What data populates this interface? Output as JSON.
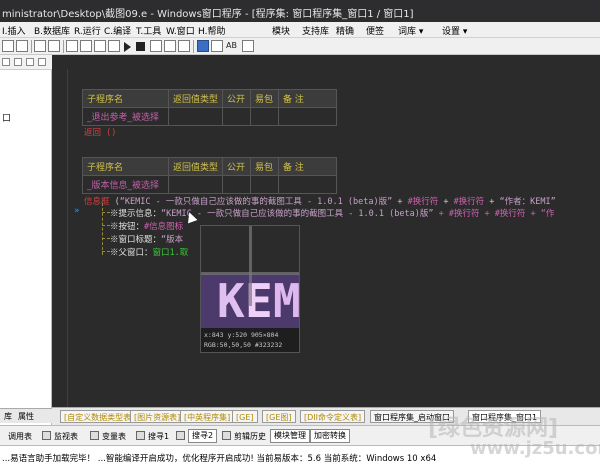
{
  "window": {
    "title": "ministrator\\Desktop\\截图09.e - Windows窗口程序 - [程序集: 窗口程序集_窗口1 / 窗口1]"
  },
  "menu": {
    "items": [
      "I.插入",
      "B.数据库",
      "R.运行",
      "C.编译",
      "T.工具",
      "W.窗口",
      "H.帮助"
    ],
    "right_items": [
      "模块",
      "支持库",
      "精确",
      "便签",
      "词库 ▾",
      "设置 ▾"
    ]
  },
  "left_panel": {
    "rows": [
      "",
      "口"
    ],
    "bottom_tabs": [
      "库",
      "属性"
    ]
  },
  "editor": {
    "table1": {
      "headers": [
        "子程序名",
        "返回值类型",
        "公开",
        "易包",
        "备 注"
      ],
      "row": [
        "_退出参考_被选择",
        "",
        "",
        "",
        ""
      ]
    },
    "line_return": "返回 ()",
    "table2": {
      "headers": [
        "子程序名",
        "返回值类型",
        "公开",
        "易包",
        "备 注"
      ],
      "row": [
        "_版本信息_被选择",
        "",
        "",
        "",
        ""
      ]
    },
    "infobox": {
      "fn": "信息框",
      "open": " (",
      "str1": "“KEMIC - 一款只做自己应该做的事的截图工具 - 1.0.1 (beta)版”",
      "op1": " + ",
      "k1": "#换行符",
      "op2": " + ",
      "k2": "#换行符",
      "op3": " + ",
      "str2": "“作者：KEMI”"
    },
    "params": [
      {
        "label": "※提示信息：",
        "value": "“KEMIC - 一款只做自己应该做的事的截图工具 - 1.0.1 (beta)版”",
        "tail": " + #换行符 + #换行符 + “作"
      },
      {
        "label": "※按钮：",
        "value": "#信息图标",
        "tail": ""
      },
      {
        "label": "※窗口标题：",
        "value": "“版本",
        "tail": ""
      },
      {
        "label": "※父窗口：",
        "value": "窗口1.取",
        "tail": ""
      }
    ],
    "arrows": "»"
  },
  "magnifier": {
    "letters": [
      "K",
      "E",
      "M"
    ],
    "coords": "x:843 y:520 905×804",
    "color": "RGB:50,50,50 #323232"
  },
  "tabs": [
    "[自定义数据类型表]",
    "[图片资源表]",
    "[中英程序集]",
    "[GE]",
    "[GE图]",
    "[DII命令定义表]",
    "窗口程序集_启动窗口",
    "窗口程序集_窗口1"
  ],
  "status": {
    "items": [
      "调用表",
      "监视表",
      "变量表",
      "搜寻1",
      "搜寻2",
      "剪辑历史",
      "模块管理",
      "加密转换"
    ]
  },
  "output": {
    "text": "...易语言助手加载完毕！  ...智能编译开启成功，优化程序开启成功!  当前易版本：5.6  当前系统：Windows 10 x64"
  },
  "watermark": {
    "line1": "[绿色资源网]",
    "line2": "www.jz5u.com"
  },
  "colors": {
    "editor_bg": "#2b2b2b",
    "header_text": "#d2c24a",
    "sub_name": "#c060a8",
    "keyword": "#d04040"
  }
}
